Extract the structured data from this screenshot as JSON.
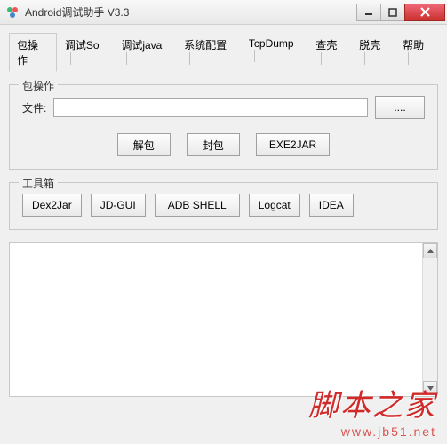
{
  "window": {
    "title": "Android调试助手 V3.3"
  },
  "tabs": [
    {
      "label": "包操作",
      "active": true
    },
    {
      "label": "调试So"
    },
    {
      "label": "调试java"
    },
    {
      "label": "系统配置"
    },
    {
      "label": "TcpDump"
    },
    {
      "label": "查壳"
    },
    {
      "label": "脱壳"
    },
    {
      "label": "帮助"
    }
  ],
  "pkg": {
    "legend": "包操作",
    "file_label": "文件:",
    "file_value": "",
    "browse": "....",
    "unpack": "解包",
    "pack": "封包",
    "exe2jar": "EXE2JAR"
  },
  "toolbox": {
    "legend": "工具箱",
    "dex2jar": "Dex2Jar",
    "jdgui": "JD-GUI",
    "adbshell": "ADB SHELL",
    "logcat": "Logcat",
    "idea": "IDEA"
  },
  "watermark": {
    "text": "脚本之家",
    "url": "www.jb51.net"
  }
}
